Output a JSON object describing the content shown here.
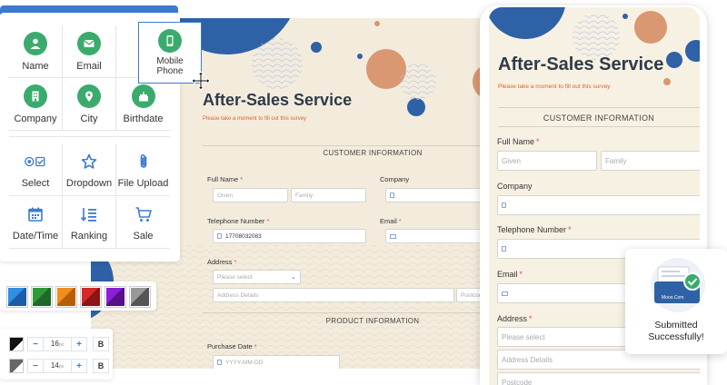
{
  "widgets": {
    "row1": [
      {
        "label": "Name",
        "icon": "person-icon"
      },
      {
        "label": "Email",
        "icon": "envelope-icon"
      }
    ],
    "row2": [
      {
        "label": "Company",
        "icon": "building-icon"
      },
      {
        "label": "City",
        "icon": "location-pin-icon"
      },
      {
        "label": "Birthdate",
        "icon": "cake-icon"
      }
    ],
    "row3": [
      {
        "label": "Select",
        "icon": "radio-checkbox-icon"
      },
      {
        "label": "Dropdown",
        "icon": "star-icon"
      },
      {
        "label": "File Upload",
        "icon": "paperclip-icon"
      }
    ],
    "row4": [
      {
        "label": "Date/Time",
        "icon": "calendar-icon"
      },
      {
        "label": "Ranking",
        "icon": "ranking-icon"
      },
      {
        "label": "Sale",
        "icon": "cart-icon"
      }
    ],
    "dragging": {
      "label_line1": "Mobile",
      "label_line2": "Phone",
      "icon": "mobile-phone-icon"
    }
  },
  "colors": {
    "accent": "#3d7bd0",
    "widget_green": "#3bab6d",
    "swatches": [
      "#2f8fe6",
      "#2e9a3a",
      "#f28c1c",
      "#d62828",
      "#8a1fd6",
      "#777777"
    ]
  },
  "font_controls": [
    {
      "color": "#111111",
      "size": "16",
      "unit": "px",
      "minus": "−",
      "plus": "+",
      "bold": "B"
    },
    {
      "color": "#666666",
      "size": "14",
      "unit": "px",
      "minus": "−",
      "plus": "+",
      "bold": "B"
    }
  ],
  "form": {
    "title": "After-Sales Service",
    "subtitle": "Please take a moment to fill out this survey",
    "section_customer": "CUSTOMER INFORMATION",
    "section_product": "PRODUCT INFORMATION",
    "full_name_label": "Full Name",
    "given_placeholder": "Given",
    "family_placeholder": "Family",
    "company_label": "Company",
    "telephone_label": "Telephone Number",
    "telephone_value": "17708032083",
    "email_label": "Email",
    "address_label": "Address",
    "please_select": "Please select",
    "address_details": "Address Details",
    "postcode": "Postcode",
    "purchase_date_label": "Purchase Date",
    "date_placeholder": "YYYY-MM-DD",
    "required_mark": "*"
  },
  "toast": {
    "message_line1": "Submitted",
    "message_line2": "Successfully!",
    "brand": "Mooo.Com"
  }
}
